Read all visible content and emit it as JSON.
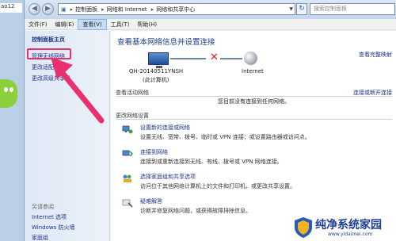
{
  "desktop": {
    "peek_text": "ao12"
  },
  "window": {
    "address": {
      "segments": [
        "控制面板",
        "网络和 Internet",
        "网络和共享中心"
      ]
    },
    "search_placeholder": "搜索控制面板",
    "menu": [
      "文件(F)",
      "编辑(E)",
      "查看(V)",
      "工具(T)",
      "帮助(H)"
    ]
  },
  "sidebar": {
    "items": [
      "控制面板主页",
      "管理无线网络",
      "更改适配器",
      "更改高级共享设"
    ],
    "see_also_title": "另请参阅",
    "see_also": [
      "Internet 选项",
      "Windows 防火墙",
      "家庭组"
    ]
  },
  "main": {
    "title": "查看基本网络信息并设置连接",
    "full_map": "查看完整映射",
    "computer_name": "QH-20140511YNSH",
    "computer_sub": "(此计算机)",
    "internet_label": "Internet",
    "active_section": "查看活动网络",
    "connect_or_disconnect": "连接或断开连接",
    "active_msg": "您目前没有连接到任何网络。",
    "settings_section": "更改网络设置",
    "tasks": [
      {
        "link": "设置新的连接或网络",
        "desc": "设置无线、宽带、拨号、临时或 VPN 连接；或设置路由器或访问点。"
      },
      {
        "link": "连接到网络",
        "desc": "连接到或重新连接到无线、有线、拨号或 VPN 网络连接。"
      },
      {
        "link": "选择家庭组和共享选项",
        "desc": "访问位于其他网络计算机上的文件和打印机，或更改共享设置。"
      },
      {
        "link": "疑难解答",
        "desc": "诊断并修复网络问题，或获得故障排除信息。"
      }
    ]
  },
  "watermark": {
    "title": "纯净系统家园",
    "url": "www.yidaimei.com"
  },
  "colors": {
    "highlight": "#e8316e",
    "link": "#1e3287"
  }
}
